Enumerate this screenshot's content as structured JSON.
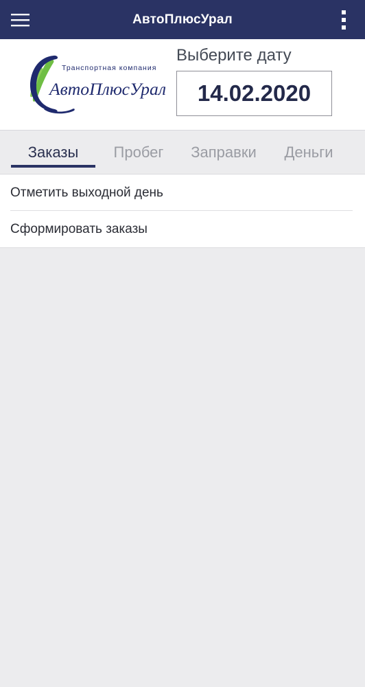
{
  "appbar": {
    "title": "АвтоПлюсУрал",
    "menu_icon": "hamburger-menu-icon",
    "more_icon": "more-vertical-icon",
    "background": "#2a3364"
  },
  "logo": {
    "tagline": "Транспортная компания",
    "wordmark": "АвтоПлюсУрал",
    "colors": {
      "navy": "#1f2a6e",
      "green": "#6fbe44"
    }
  },
  "date_picker": {
    "caption": "Выберите дату",
    "value": "14.02.2020"
  },
  "tabs": [
    {
      "label": "Заказы",
      "active": true
    },
    {
      "label": "Пробег",
      "active": false
    },
    {
      "label": "Заправки",
      "active": false
    },
    {
      "label": "Деньги",
      "active": false
    }
  ],
  "menu": {
    "items": [
      {
        "label": "Отметить выходной день"
      },
      {
        "label": "Сформировать заказы"
      }
    ]
  },
  "colors": {
    "accent": "#2a3364",
    "tab_inactive": "#9a9ca3",
    "background": "#ececee"
  }
}
